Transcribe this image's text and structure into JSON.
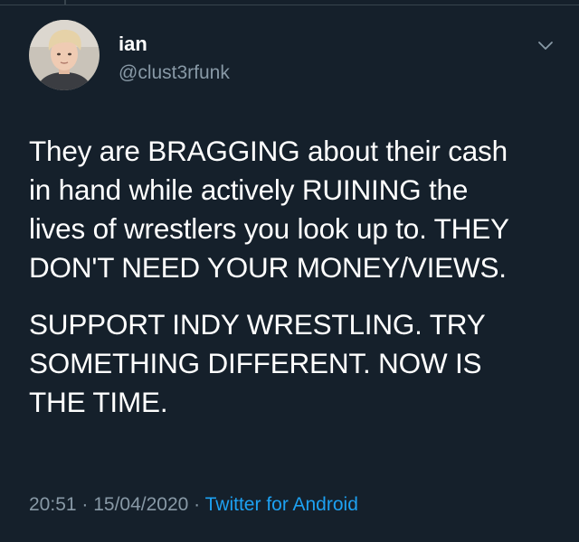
{
  "author": {
    "name": "ian",
    "handle": "@clust3rfunk",
    "avatar_icon": "user-photo-avatar"
  },
  "header": {
    "menu_icon": "chevron-down-icon"
  },
  "tweet": {
    "paragraphs": [
      "They are BRAGGING about their cash\nin hand while actively RUINING the\nlives of wrestlers you look up to. THEY\nDON'T NEED YOUR MONEY/VIEWS.",
      "SUPPORT INDY WRESTLING. TRY\nSOMETHING DIFFERENT. NOW IS\nTHE TIME."
    ]
  },
  "meta": {
    "time": "20:51",
    "separator": " · ",
    "date": "15/04/2020",
    "source": "Twitter for Android"
  },
  "colors": {
    "background": "#15202b",
    "text_primary": "#ffffff",
    "text_secondary": "#8899a6",
    "link": "#1da1f2",
    "divider": "#38444d"
  }
}
